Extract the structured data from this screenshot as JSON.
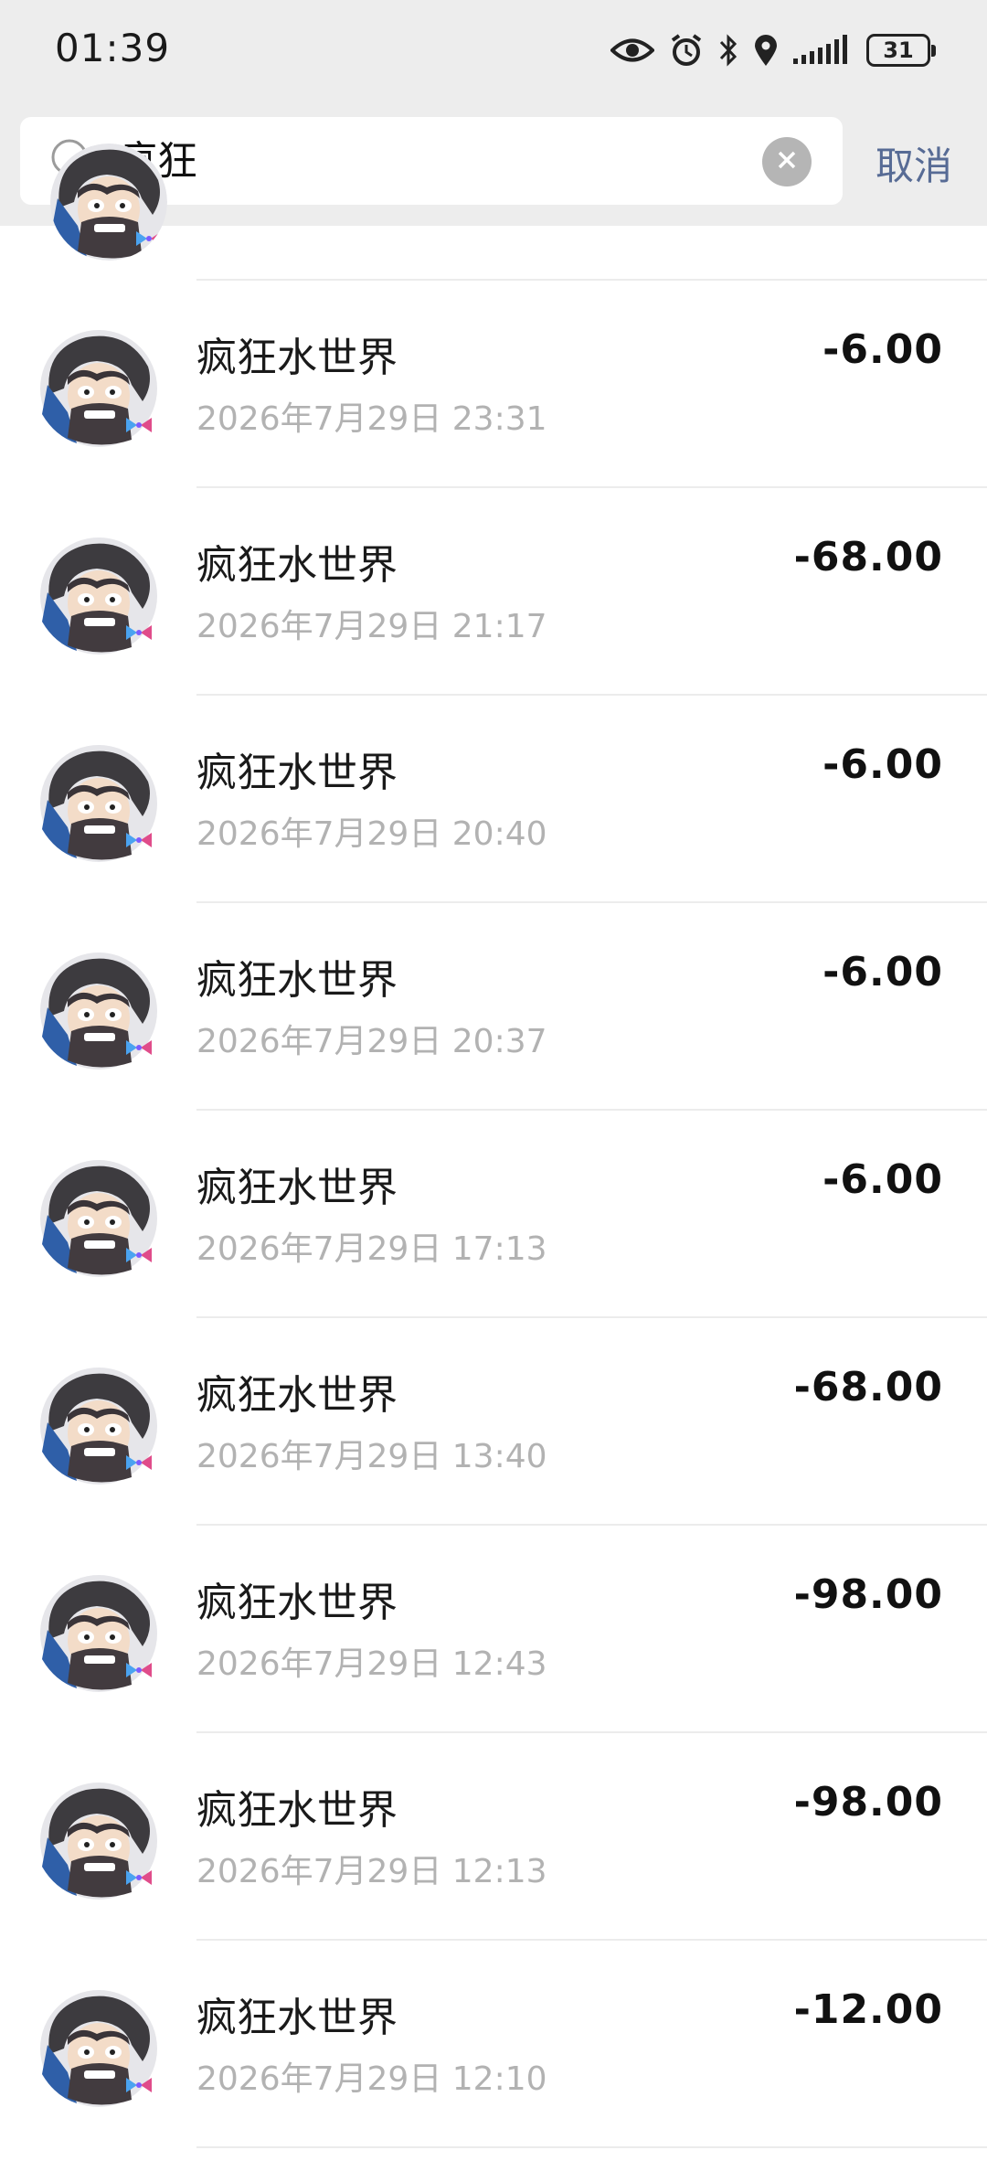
{
  "status_bar": {
    "time": "01:39",
    "battery_level": "31",
    "icons": [
      "eye-icon",
      "alarm-icon",
      "bluetooth-icon",
      "location-icon",
      "signal-icon",
      "battery-icon"
    ]
  },
  "search": {
    "query": "疯狂",
    "cancel_label": "取消"
  },
  "colors": {
    "link": "#576b95",
    "secondary_text": "#b2b2b2",
    "header_bg": "#ededed"
  },
  "transactions": [
    {
      "name": "疯狂水世界",
      "date": "2026年7月29日 23:31",
      "amount": "-6.00"
    },
    {
      "name": "疯狂水世界",
      "date": "2026年7月29日 21:17",
      "amount": "-68.00"
    },
    {
      "name": "疯狂水世界",
      "date": "2026年7月29日 20:40",
      "amount": "-6.00"
    },
    {
      "name": "疯狂水世界",
      "date": "2026年7月29日 20:37",
      "amount": "-6.00"
    },
    {
      "name": "疯狂水世界",
      "date": "2026年7月29日 17:13",
      "amount": "-6.00"
    },
    {
      "name": "疯狂水世界",
      "date": "2026年7月29日 13:40",
      "amount": "-68.00"
    },
    {
      "name": "疯狂水世界",
      "date": "2026年7月29日 12:43",
      "amount": "-98.00"
    },
    {
      "name": "疯狂水世界",
      "date": "2026年7月29日 12:13",
      "amount": "-98.00"
    },
    {
      "name": "疯狂水世界",
      "date": "2026年7月29日 12:10",
      "amount": "-12.00"
    }
  ]
}
